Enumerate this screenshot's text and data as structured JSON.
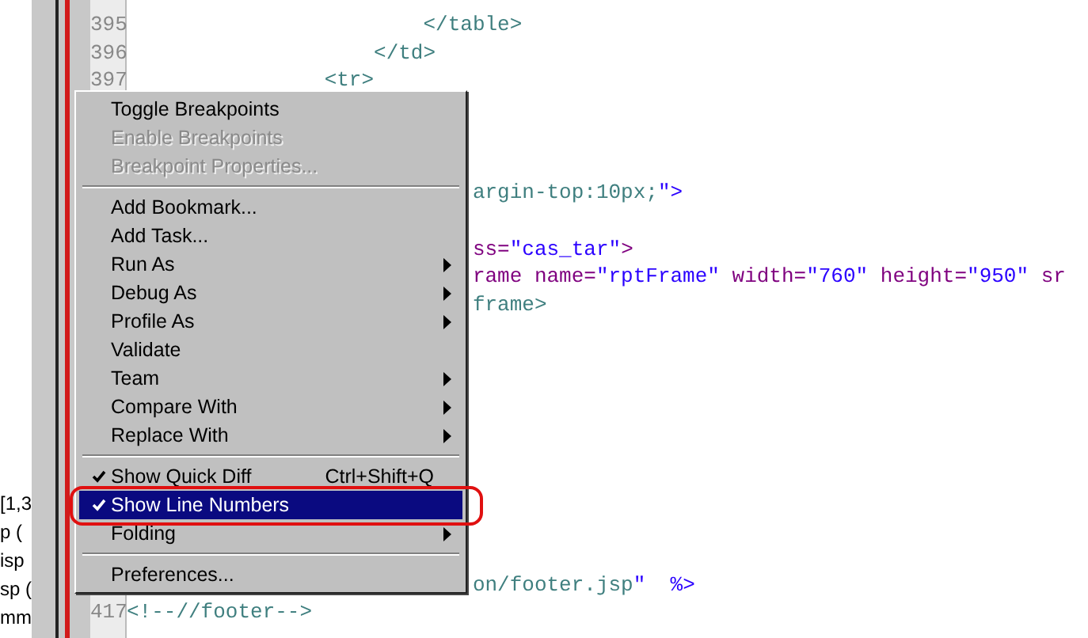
{
  "side_panel": {
    "lines": [
      "[1,3",
      "p (",
      "isp",
      "sp (",
      "mm"
    ]
  },
  "editor": {
    "lines": [
      {
        "kind": "code",
        "number": "395",
        "text": "                        </table>"
      },
      {
        "kind": "code",
        "number": "396",
        "text": "                    </td>"
      },
      {
        "kind": "code",
        "number": "397",
        "text": "                <tr>"
      },
      {
        "kind": "blank"
      },
      {
        "kind": "blank"
      },
      {
        "kind": "blank"
      },
      {
        "kind": "code",
        "text": "                            argin-top:10px;\">"
      },
      {
        "kind": "blank"
      },
      {
        "kind": "code",
        "text": "                            ss=\"cas_tar\">"
      },
      {
        "kind": "code",
        "text": "                            rame name=\"rptFrame\" width=\"760\" height=\"950\" sr"
      },
      {
        "kind": "code",
        "text": "                            frame>"
      },
      {
        "kind": "blank"
      },
      {
        "kind": "blank"
      },
      {
        "kind": "blank"
      },
      {
        "kind": "blank"
      },
      {
        "kind": "blank"
      },
      {
        "kind": "blank"
      },
      {
        "kind": "blank"
      },
      {
        "kind": "blank"
      },
      {
        "kind": "blank"
      },
      {
        "kind": "code",
        "text": "                            on/footer.jsp\"  %>"
      },
      {
        "kind": "code",
        "number": "417",
        "text": "<!--//footer-->"
      }
    ]
  },
  "context_menu": {
    "items": [
      {
        "kind": "item",
        "label": "Toggle Breakpoints",
        "disabled": false,
        "checked": false,
        "selected": false,
        "submenu": false
      },
      {
        "kind": "item",
        "label": "Enable Breakpoints",
        "disabled": true,
        "checked": false,
        "selected": false,
        "submenu": false
      },
      {
        "kind": "item",
        "label": "Breakpoint Properties...",
        "disabled": true,
        "checked": false,
        "selected": false,
        "submenu": false
      },
      {
        "kind": "separator"
      },
      {
        "kind": "item",
        "label": "Add Bookmark...",
        "disabled": false,
        "checked": false,
        "selected": false,
        "submenu": false
      },
      {
        "kind": "item",
        "label": "Add Task...",
        "disabled": false,
        "checked": false,
        "selected": false,
        "submenu": false
      },
      {
        "kind": "item",
        "label": "Run As",
        "disabled": false,
        "checked": false,
        "selected": false,
        "submenu": true
      },
      {
        "kind": "item",
        "label": "Debug As",
        "disabled": false,
        "checked": false,
        "selected": false,
        "submenu": true
      },
      {
        "kind": "item",
        "label": "Profile As",
        "disabled": false,
        "checked": false,
        "selected": false,
        "submenu": true
      },
      {
        "kind": "item",
        "label": "Validate",
        "disabled": false,
        "checked": false,
        "selected": false,
        "submenu": false
      },
      {
        "kind": "item",
        "label": "Team",
        "disabled": false,
        "checked": false,
        "selected": false,
        "submenu": true
      },
      {
        "kind": "item",
        "label": "Compare With",
        "disabled": false,
        "checked": false,
        "selected": false,
        "submenu": true
      },
      {
        "kind": "item",
        "label": "Replace With",
        "disabled": false,
        "checked": false,
        "selected": false,
        "submenu": true
      },
      {
        "kind": "separator"
      },
      {
        "kind": "item",
        "label": "Show Quick Diff",
        "shortcut": "Ctrl+Shift+Q",
        "disabled": false,
        "checked": true,
        "selected": false,
        "submenu": false
      },
      {
        "kind": "item",
        "label": "Show Line Numbers",
        "disabled": false,
        "checked": true,
        "selected": true,
        "submenu": false
      },
      {
        "kind": "item",
        "label": "Folding",
        "disabled": false,
        "checked": false,
        "selected": false,
        "submenu": true
      },
      {
        "kind": "separator"
      },
      {
        "kind": "item",
        "label": "Preferences...",
        "disabled": false,
        "checked": false,
        "selected": false,
        "submenu": false
      }
    ]
  }
}
